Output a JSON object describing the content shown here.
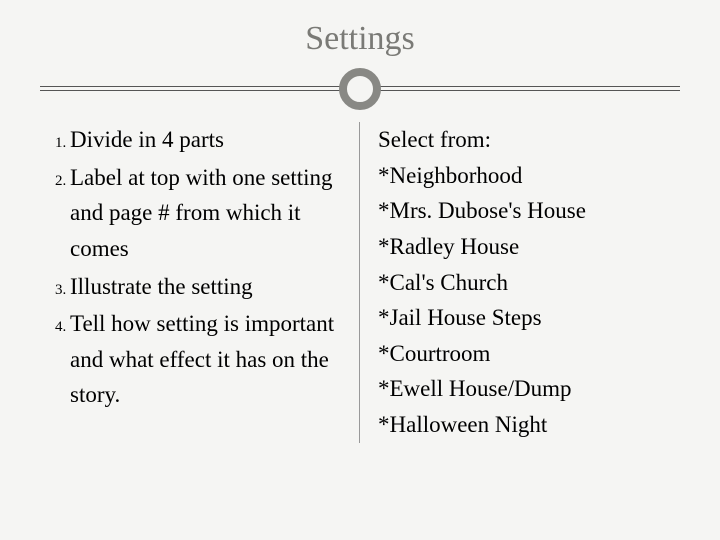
{
  "title": "Settings",
  "left": {
    "items": [
      "Divide in 4 parts",
      "Label at top with one setting and page # from which it comes",
      "Illustrate the setting",
      "Tell how setting is important and what effect it has on the story."
    ]
  },
  "right": {
    "heading": "Select from:",
    "options": [
      "*Neighborhood",
      "*Mrs. Dubose's House",
      "*Radley House",
      "*Cal's Church",
      "*Jail House Steps",
      "*Courtroom",
      "*Ewell House/Dump",
      "*Halloween Night"
    ]
  }
}
